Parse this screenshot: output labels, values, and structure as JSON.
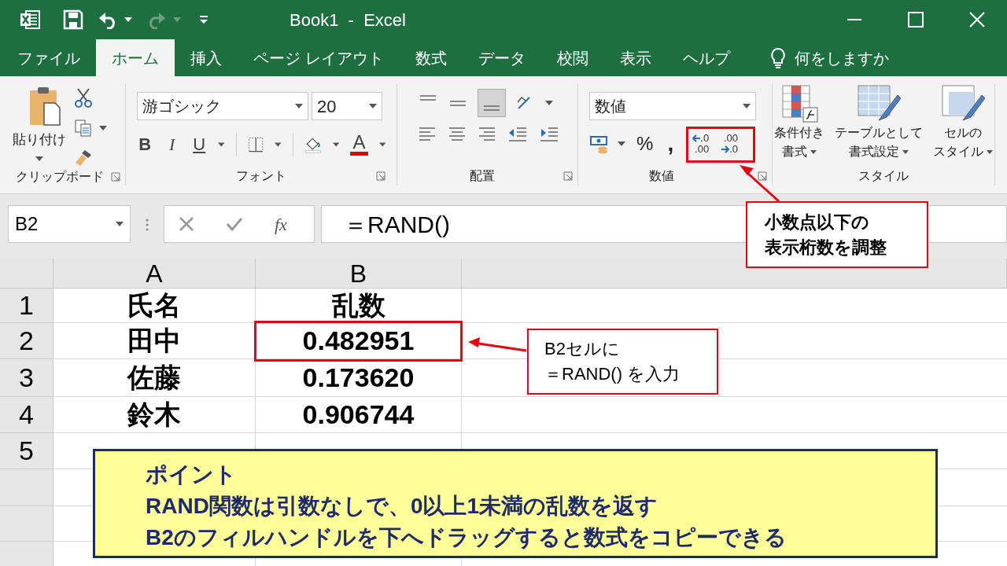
{
  "window": {
    "title": "Book1  -  Excel"
  },
  "quick_access": [
    {
      "kind": "save",
      "disabled": false
    },
    {
      "kind": "undo",
      "disabled": false
    },
    {
      "kind": "redo",
      "disabled": true
    }
  ],
  "tabs": [
    {
      "label": "ファイル",
      "selected": false
    },
    {
      "label": "ホーム",
      "selected": true
    },
    {
      "label": "挿入",
      "selected": false
    },
    {
      "label": "ページ レイアウト",
      "selected": false
    },
    {
      "label": "数式",
      "selected": false
    },
    {
      "label": "データ",
      "selected": false
    },
    {
      "label": "校閲",
      "selected": false
    },
    {
      "label": "表示",
      "selected": false
    },
    {
      "label": "ヘルプ",
      "selected": false
    }
  ],
  "tell_me": "何をしますか",
  "ribbon": {
    "clipboard": {
      "paste": "貼り付け",
      "label": "クリップボード"
    },
    "font": {
      "name": "游ゴシック",
      "size": "20",
      "bold": "B",
      "italic": "I",
      "underline": "U",
      "font_color": "A",
      "label": "フォント"
    },
    "alignment": {
      "label": "配置"
    },
    "number": {
      "format": "数値",
      "percent": "%",
      "comma": ",",
      "increase_decimal": [
        ".0",
        ".00"
      ],
      "decrease_decimal": [
        ".00",
        ".0"
      ],
      "label": "数値"
    },
    "styles": {
      "label": "スタイル",
      "buttons": [
        {
          "lines": [
            "条件付き",
            "書式"
          ]
        },
        {
          "lines": [
            "テーブルとして",
            "書式設定"
          ]
        },
        {
          "lines": [
            "セルの",
            "スタイル"
          ]
        }
      ]
    }
  },
  "formula_bar": {
    "name_box": "B2",
    "fx": "fx",
    "formula": "＝RAND()"
  },
  "sheet": {
    "columns": [
      "A",
      "B"
    ],
    "rows": [
      {
        "number": "1",
        "cells": [
          "氏名",
          "乱数"
        ]
      },
      {
        "number": "2",
        "cells": [
          "田中",
          "0.482951"
        ]
      },
      {
        "number": "3",
        "cells": [
          "佐藤",
          "0.173620"
        ]
      },
      {
        "number": "4",
        "cells": [
          "鈴木",
          "0.906744"
        ]
      },
      {
        "number": "5",
        "cells": []
      }
    ]
  },
  "callouts": [
    {
      "lines": [
        "小数点以下の",
        "表示桁数を調整"
      ]
    },
    {
      "lines": [
        "B2セルに",
        "＝RAND() を入力"
      ]
    }
  ],
  "note": {
    "title": "ポイント",
    "lines": [
      "RAND関数は引数なしで、0以上1未満の乱数を返す",
      "B2のフィルハンドルを下へドラッグすると数式をコピーできる"
    ]
  }
}
